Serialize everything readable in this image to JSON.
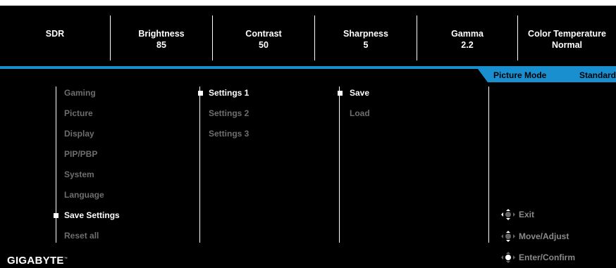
{
  "status_bar": [
    {
      "label": "SDR",
      "value": ""
    },
    {
      "label": "Brightness",
      "value": "85"
    },
    {
      "label": "Contrast",
      "value": "50"
    },
    {
      "label": "Sharpness",
      "value": "5"
    },
    {
      "label": "Gamma",
      "value": "2.2"
    },
    {
      "label": "Color Temperature",
      "value": "Normal"
    }
  ],
  "picture_mode": {
    "label": "Picture Mode",
    "value": "Standard"
  },
  "main_menu": [
    "Gaming",
    "Picture",
    "Display",
    "PIP/PBP",
    "System",
    "Language",
    "Save Settings",
    "Reset all"
  ],
  "submenu": [
    "Settings 1",
    "Settings 2",
    "Settings 3"
  ],
  "actions": [
    "Save",
    "Load"
  ],
  "hints": {
    "exit": "Exit",
    "move": "Move/Adjust",
    "confirm": "Enter/Confirm"
  },
  "brand": {
    "name": "GIGABYTE",
    "tm": "™"
  },
  "colors": {
    "accent": "#1a8fd0",
    "background": "#000000",
    "inactive": "#6e6e6e",
    "active": "#ffffff"
  },
  "icons": {
    "joystick": "joystick-icon"
  }
}
